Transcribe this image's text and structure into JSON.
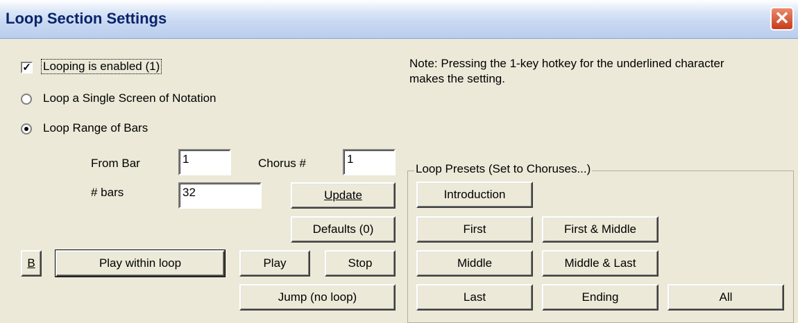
{
  "window": {
    "title": "Loop Section Settings",
    "close_glyph": "✕"
  },
  "options": {
    "looping_enabled": {
      "label": "Looping is enabled (1)",
      "checked": true
    },
    "loop_single_screen": {
      "label": "Loop a Single Screen of Notation",
      "selected": false
    },
    "loop_range": {
      "label": "Loop Range of Bars",
      "selected": true
    }
  },
  "note": {
    "line1": "Note: Pressing the 1-key hotkey for the underlined character",
    "line2": "makes the setting."
  },
  "fields": {
    "from_bar": {
      "label": "From Bar",
      "value": "1"
    },
    "chorus": {
      "label": "Chorus #",
      "value": "1"
    },
    "num_bars": {
      "label": "# bars",
      "value": "32"
    }
  },
  "buttons": {
    "update": "Update",
    "defaults": "Defaults (0)",
    "b": "B",
    "play_within_loop": "Play within loop",
    "play": "Play",
    "stop": "Stop",
    "jump": "Jump (no loop)"
  },
  "presets": {
    "group_label": "Loop Presets (Set to Choruses...)",
    "introduction": "Introduction",
    "first": "First",
    "first_middle": "First & Middle",
    "middle": "Middle",
    "middle_last": "Middle & Last",
    "last": "Last",
    "ending": "Ending",
    "all": "All"
  },
  "icons": {
    "checkmark": "check-icon",
    "close": "close-icon",
    "radio": "radio-dot-icon"
  }
}
